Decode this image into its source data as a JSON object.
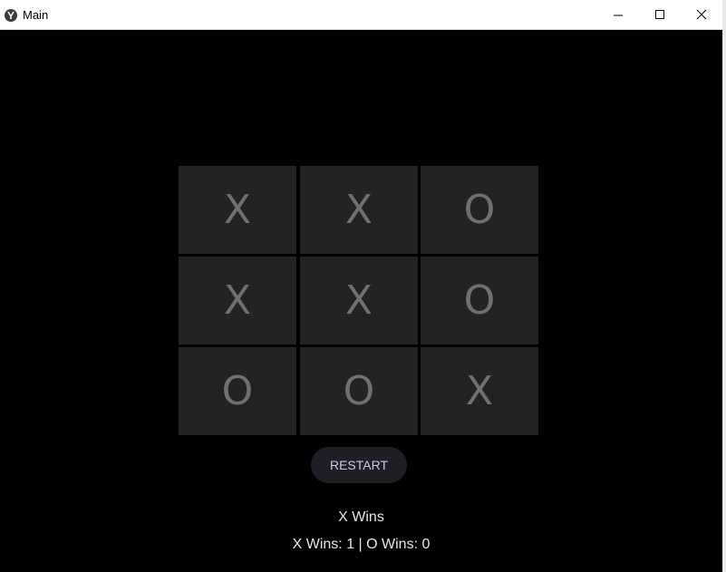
{
  "window": {
    "title": "Main",
    "app_icon": "kivy-logo-icon",
    "controls": {
      "minimize_icon": "minimize-icon",
      "maximize_icon": "maximize-icon",
      "close_icon": "close-icon"
    }
  },
  "board": {
    "cells": [
      "X",
      "X",
      "O",
      "X",
      "X",
      "O",
      "O",
      "O",
      "X"
    ]
  },
  "restart_label": "RESTART",
  "status": {
    "winner": "X Wins",
    "score": "X Wins: 1 | O Wins: 0"
  },
  "colors": {
    "background": "#000000",
    "cell": "#232323",
    "mark": "#707070",
    "restart_bg": "#1e1e24",
    "restart_text": "#c9c9f2",
    "status_text": "#e6e6e6"
  }
}
